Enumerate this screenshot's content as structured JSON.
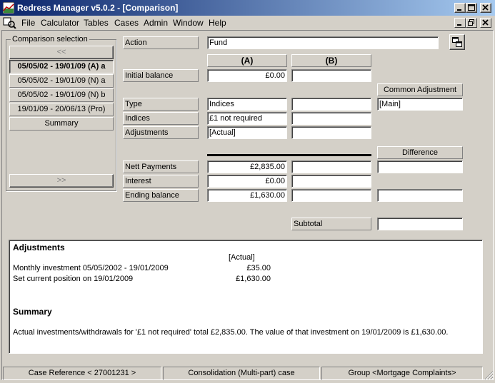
{
  "window": {
    "title": "Redress Manager v5.0.2 - [Comparison]",
    "app_icon": "app-chart-icon",
    "minimize_icon": "minimize-icon",
    "maximize_icon": "maximize-icon",
    "close_icon": "close-icon"
  },
  "menu": {
    "items": [
      "File",
      "Calculator",
      "Tables",
      "Cases",
      "Admin",
      "Window",
      "Help"
    ]
  },
  "comparison_selection": {
    "title": "Comparison selection",
    "scroll_up": "<<",
    "scroll_down": ">>",
    "items": [
      "05/05/02 - 19/01/09 (A) a",
      "05/05/02 - 19/01/09 (N) a",
      "05/05/02 - 19/01/09 (N) b",
      "19/01/09 - 20/06/13 (Pro)",
      "Summary"
    ]
  },
  "form": {
    "action_label": "Action",
    "action_value": "Fund",
    "col_a": "(A)",
    "col_b": "(B)",
    "initial_balance_label": "Initial balance",
    "initial_balance_a": "£0.00",
    "initial_balance_b": "",
    "common_adjustment_label": "Common Adjustment",
    "common_adjustment_value": "[Main]",
    "type_label": "Type",
    "type_a": "Indices",
    "type_b": "",
    "indices_label": "Indices",
    "indices_a": "£1 not required",
    "indices_b": "",
    "adjustments_label": "Adjustments",
    "adjustments_a": "[Actual]",
    "adjustments_b": "",
    "difference_label": "Difference",
    "nett_payments_label": "Nett Payments",
    "nett_payments_a": "£2,835.00",
    "nett_payments_b": "",
    "nett_payments_diff": "",
    "interest_label": "Interest",
    "interest_a": "£0.00",
    "interest_b": "",
    "ending_balance_label": "Ending balance",
    "ending_balance_a": "£1,630.00",
    "ending_balance_b": "",
    "ending_balance_diff": "",
    "subtotal_label": "Subtotal",
    "subtotal_value": ""
  },
  "report": {
    "adjustments_heading": "Adjustments",
    "actual_col": "[Actual]",
    "rows": [
      {
        "label": "Monthly investment 05/05/2002 - 19/01/2009",
        "value": "£35.00"
      },
      {
        "label": "Set current position on 19/01/2009",
        "value": "£1,630.00"
      }
    ],
    "summary_heading": "Summary",
    "summary_text": "Actual investments/withdrawals for '£1 not required' total £2,835.00. The value of that investment on 19/01/2009 is £1,630.00."
  },
  "status": {
    "case_reference": "Case Reference < 27001231 >",
    "consolidation": "Consolidation (Multi-part) case",
    "group": "Group <Mortgage Complaints>"
  }
}
